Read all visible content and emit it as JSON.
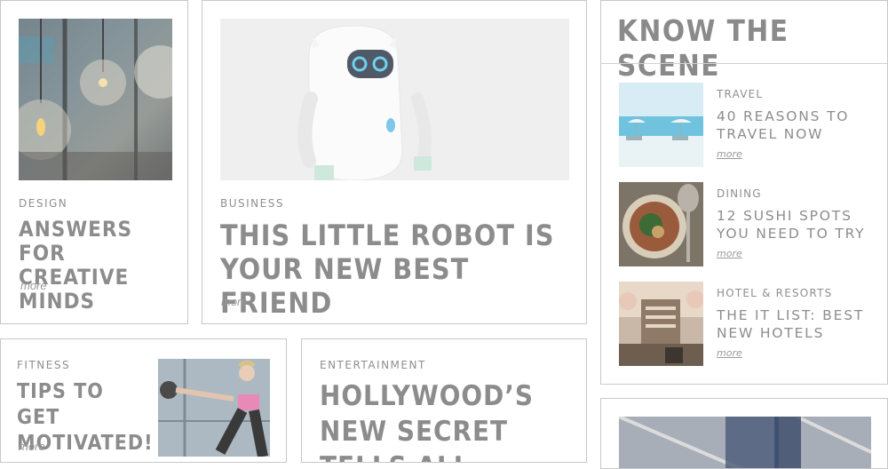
{
  "cards": {
    "design": {
      "category": "DESIGN",
      "headline": "ANSWERS FOR CREATIVE MINDS",
      "more": "more"
    },
    "business": {
      "category": "BUSINESS",
      "headline": "THIS LITTLE ROBOT IS YOUR NEW BEST FRIEND",
      "more": "more"
    },
    "fitness": {
      "category": "FITNESS",
      "headline": "TIPS TO GET MOTIVATED!",
      "more": "more"
    },
    "entertainment": {
      "category": "ENTERTAINMENT",
      "headline": "HOLLYWOOD’S NEW SECRET TELLS ALL"
    }
  },
  "sidebar": {
    "title": "KNOW THE SCENE",
    "items": [
      {
        "category": "TRAVEL",
        "headline": "40 REASONS TO TRAVEL NOW",
        "more": "more"
      },
      {
        "category": "DINING",
        "headline": "12 SUSHI SPOTS YOU NEED TO TRY",
        "more": "more"
      },
      {
        "category": "HOTEL & RESORTS",
        "headline": "THE IT LIST: BEST NEW HOTELS",
        "more": "more"
      }
    ]
  },
  "colors": {
    "text": "#8a8a8a",
    "border": "#c8c8c8",
    "background": "#ffffff"
  }
}
